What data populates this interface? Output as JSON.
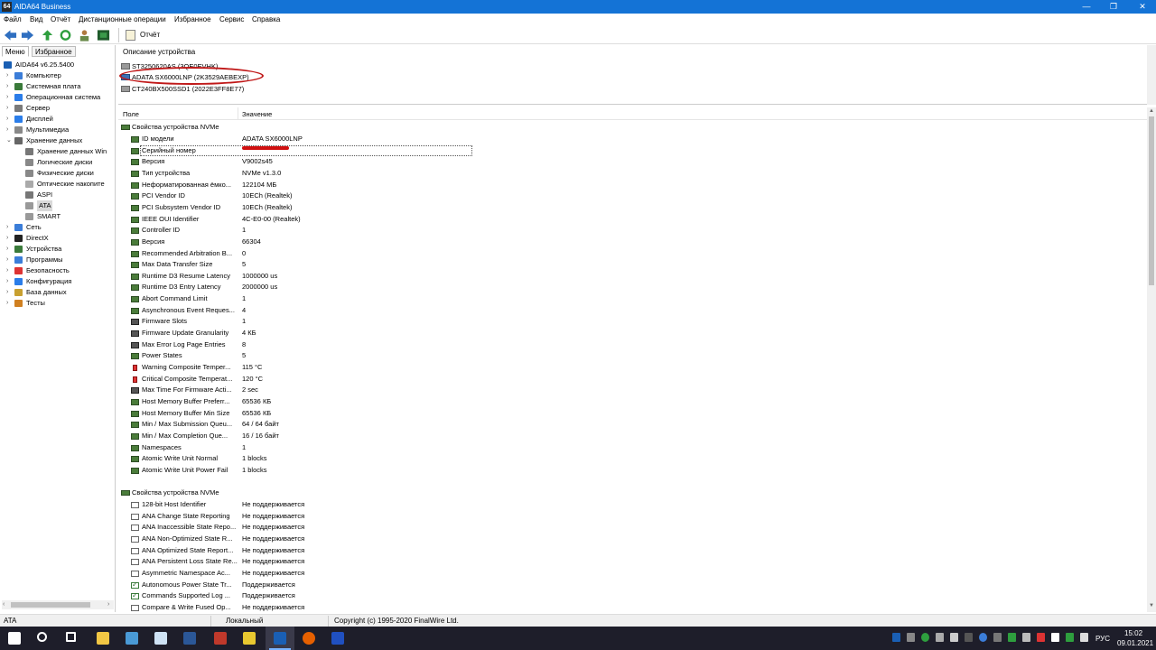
{
  "window": {
    "title": "AIDA64 Business",
    "app_icon": "64",
    "minimize": "—",
    "maximize": "❐",
    "close": "✕"
  },
  "menubar": [
    "Файл",
    "Вид",
    "Отчёт",
    "Дистанционные операции",
    "Избранное",
    "Сервис",
    "Справка"
  ],
  "toolbar": {
    "icons": [
      "back-icon",
      "forward-icon",
      "up-icon",
      "refresh-icon",
      "user-icon",
      "chip-icon"
    ],
    "report_label": "Отчёт"
  },
  "left": {
    "tabs": [
      "Меню",
      "Избранное"
    ],
    "tree": [
      {
        "label": "AIDA64 v6.25.5400",
        "level": 0,
        "expander": "",
        "icon": "aida-icon",
        "color": "#1a5fb4"
      },
      {
        "label": "Компьютер",
        "level": 1,
        "expander": "›",
        "icon": "computer-icon",
        "color": "#3b7dd8"
      },
      {
        "label": "Системная плата",
        "level": 1,
        "expander": "›",
        "icon": "motherboard-icon",
        "color": "#3a7a3a"
      },
      {
        "label": "Операционная система",
        "level": 1,
        "expander": "›",
        "icon": "windows-icon",
        "color": "#2b7de9"
      },
      {
        "label": "Сервер",
        "level": 1,
        "expander": "›",
        "icon": "server-icon",
        "color": "#7a7a7a"
      },
      {
        "label": "Дисплей",
        "level": 1,
        "expander": "›",
        "icon": "display-icon",
        "color": "#2b7de9"
      },
      {
        "label": "Мультимедиа",
        "level": 1,
        "expander": "›",
        "icon": "multimedia-icon",
        "color": "#888"
      },
      {
        "label": "Хранение данных",
        "level": 1,
        "expander": "⌄",
        "icon": "storage-icon",
        "color": "#666"
      },
      {
        "label": "Хранение данных Win",
        "level": 2,
        "expander": "",
        "icon": "storage-win-icon",
        "color": "#777"
      },
      {
        "label": "Логические диски",
        "level": 2,
        "expander": "",
        "icon": "logical-disk-icon",
        "color": "#888"
      },
      {
        "label": "Физические диски",
        "level": 2,
        "expander": "",
        "icon": "physical-disk-icon",
        "color": "#888"
      },
      {
        "label": "Оптические накопите",
        "level": 2,
        "expander": "",
        "icon": "optical-icon",
        "color": "#aaa"
      },
      {
        "label": "ASPI",
        "level": 2,
        "expander": "",
        "icon": "aspi-icon",
        "color": "#777"
      },
      {
        "label": "ATA",
        "level": 2,
        "expander": "",
        "icon": "ata-icon",
        "color": "#999",
        "selected": true
      },
      {
        "label": "SMART",
        "level": 2,
        "expander": "",
        "icon": "smart-icon",
        "color": "#999"
      },
      {
        "label": "Сеть",
        "level": 1,
        "expander": "›",
        "icon": "network-icon",
        "color": "#3b7dd8"
      },
      {
        "label": "DirectX",
        "level": 1,
        "expander": "›",
        "icon": "directx-icon",
        "color": "#222"
      },
      {
        "label": "Устройства",
        "level": 1,
        "expander": "›",
        "icon": "devices-icon",
        "color": "#3a7a3a"
      },
      {
        "label": "Программы",
        "level": 1,
        "expander": "›",
        "icon": "programs-icon",
        "color": "#3b7dd8"
      },
      {
        "label": "Безопасность",
        "level": 1,
        "expander": "›",
        "icon": "security-icon",
        "color": "#d33"
      },
      {
        "label": "Конфигурация",
        "level": 1,
        "expander": "›",
        "icon": "config-icon",
        "color": "#2b7de9"
      },
      {
        "label": "База данных",
        "level": 1,
        "expander": "›",
        "icon": "database-icon",
        "color": "#c8a030"
      },
      {
        "label": "Тесты",
        "level": 1,
        "expander": "›",
        "icon": "tests-icon",
        "color": "#d08020"
      }
    ],
    "scroll_left": "‹",
    "scroll_right": "›"
  },
  "devices": {
    "header": "Описание устройства",
    "items": [
      "ST3250620AS (3QE0EVHK)",
      "ADATA SX6000LNP (2K3529AEBEXP)",
      "CT240BX500SSD1 (2022E3FF8E77)"
    ]
  },
  "grid": {
    "col_field": "Поле",
    "col_value": "Значение",
    "section1": "Свойства устройства NVMe",
    "rows1": [
      {
        "field": "ID модели",
        "value": "ADATA SX6000LNP",
        "icon": "green"
      },
      {
        "field": "Серийный номер",
        "value": "",
        "icon": "green"
      },
      {
        "field": "Версия",
        "value": "V9002s45",
        "icon": "green"
      },
      {
        "field": "Тип устройства",
        "value": "NVMe v1.3.0",
        "icon": "green"
      },
      {
        "field": "Неформатированная ёмко...",
        "value": "122104 МБ",
        "icon": "green"
      },
      {
        "field": "PCI Vendor ID",
        "value": "10ECh  (Realtek)",
        "icon": "green"
      },
      {
        "field": "PCI Subsystem Vendor ID",
        "value": "10ECh  (Realtek)",
        "icon": "green"
      },
      {
        "field": "IEEE OUI Identifier",
        "value": "4C-E0-00  (Realtek)",
        "icon": "green"
      },
      {
        "field": "Controller ID",
        "value": "1",
        "icon": "green"
      },
      {
        "field": "Версия",
        "value": "66304",
        "icon": "green"
      },
      {
        "field": "Recommended Arbitration B...",
        "value": "0",
        "icon": "green"
      },
      {
        "field": "Max Data Transfer Size",
        "value": "5",
        "icon": "green"
      },
      {
        "field": "Runtime D3 Resume Latency",
        "value": "1000000 us",
        "icon": "green"
      },
      {
        "field": "Runtime D3 Entry Latency",
        "value": "2000000 us",
        "icon": "green"
      },
      {
        "field": "Abort Command Limit",
        "value": "1",
        "icon": "green"
      },
      {
        "field": "Asynchronous Event Reques...",
        "value": "4",
        "icon": "green"
      },
      {
        "field": "Firmware Slots",
        "value": "1",
        "icon": "chip"
      },
      {
        "field": "Firmware Update Granularity",
        "value": "4 КБ",
        "icon": "chip"
      },
      {
        "field": "Max Error Log Page Entries",
        "value": "8",
        "icon": "chip"
      },
      {
        "field": "Power States",
        "value": "5",
        "icon": "green"
      },
      {
        "field": "Warning Composite Temper...",
        "value": "115 °C",
        "icon": "temp"
      },
      {
        "field": "Critical Composite Temperat...",
        "value": "120 °C",
        "icon": "temp"
      },
      {
        "field": "Max Time For Firmware Acti...",
        "value": "2 sec",
        "icon": "chip"
      },
      {
        "field": "Host Memory Buffer Preferr...",
        "value": "65536 КБ",
        "icon": "green"
      },
      {
        "field": "Host Memory Buffer Min Size",
        "value": "65536 КБ",
        "icon": "green"
      },
      {
        "field": "Min / Max Submission Queu...",
        "value": "64 / 64 байт",
        "icon": "green"
      },
      {
        "field": "Min / Max Completion Que...",
        "value": "16 / 16 байт",
        "icon": "green"
      },
      {
        "field": "Namespaces",
        "value": "1",
        "icon": "green"
      },
      {
        "field": "Atomic Write Unit Normal",
        "value": "1 blocks",
        "icon": "green"
      },
      {
        "field": "Atomic Write Unit Power Fail",
        "value": "1 blocks",
        "icon": "green"
      }
    ],
    "section2": "Свойства устройства NVMe",
    "rows2": [
      {
        "field": "128-bit Host Identifier",
        "value": "Не поддерживается",
        "icon": "box"
      },
      {
        "field": "ANA Change State Reporting",
        "value": "Не поддерживается",
        "icon": "box"
      },
      {
        "field": "ANA Inaccessible State Repo...",
        "value": "Не поддерживается",
        "icon": "box"
      },
      {
        "field": "ANA Non-Optimized State R...",
        "value": "Не поддерживается",
        "icon": "box"
      },
      {
        "field": "ANA Optimized State Report...",
        "value": "Не поддерживается",
        "icon": "box"
      },
      {
        "field": "ANA Persistent Loss State Re...",
        "value": "Не поддерживается",
        "icon": "box"
      },
      {
        "field": "Asymmetric Namespace Ac...",
        "value": "Не поддерживается",
        "icon": "box"
      },
      {
        "field": "Autonomous Power State Tr...",
        "value": "Поддерживается",
        "icon": "boxchk"
      },
      {
        "field": "Commands Supported Log ...",
        "value": "Поддерживается",
        "icon": "boxchk"
      },
      {
        "field": "Compare & Write Fused Op...",
        "value": "Не поддерживается",
        "icon": "box"
      }
    ]
  },
  "status": {
    "left": "ATA",
    "middle": "Локальный",
    "right": "Copyright (c) 1995-2020 FinalWire Ltd."
  },
  "taskbar": {
    "apps": [
      {
        "name": "start-icon",
        "color": "#ffffff"
      },
      {
        "name": "search-icon",
        "color": "#ffffff"
      },
      {
        "name": "task-view-icon",
        "color": "#ffffff"
      },
      {
        "name": "file-explorer-icon",
        "color": "#f2c744"
      },
      {
        "name": "app-icon",
        "color": "#4a9ad6"
      },
      {
        "name": "notepad-icon",
        "color": "#cfe3f5"
      },
      {
        "name": "word-icon",
        "color": "#2b5797"
      },
      {
        "name": "app2-icon",
        "color": "#c0392b"
      },
      {
        "name": "app3-icon",
        "color": "#e8c830"
      },
      {
        "name": "aida64-icon",
        "color": "#1a5fb4"
      },
      {
        "name": "firefox-icon",
        "color": "#e66000"
      },
      {
        "name": "app4-icon",
        "color": "#2050c0"
      }
    ],
    "lang": "РУС",
    "time": "15:02",
    "date": "09.01.2021"
  }
}
